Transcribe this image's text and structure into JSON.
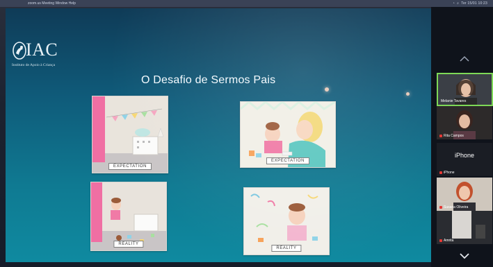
{
  "menubar": {
    "left_text": "zoom.us   Meeting   Window   Help",
    "clock": "Ter 15/01 10:23"
  },
  "slide": {
    "logo_word": "IAC",
    "logo_subtitle": "Instituto de Apoio à Criança",
    "title": "O Desafio de Sermos Pais",
    "cards": [
      {
        "caption": "EXPECTATION"
      },
      {
        "caption": "EXPECTATION"
      },
      {
        "caption": "REALITY"
      },
      {
        "caption": "REALITY"
      }
    ]
  },
  "participants": [
    {
      "name": "Melanie Tavares"
    },
    {
      "name": "Rita Campos"
    },
    {
      "name": "iPhone",
      "big_label": "iPhone"
    },
    {
      "name": "Susana Oliveira"
    },
    {
      "name": "Amrita"
    }
  ],
  "colors": {
    "slide_top": "#0f3b57",
    "slide_bottom": "#0f8aa0",
    "active_speaker_border": "#7ed957",
    "mic_muted": "#e53935"
  }
}
